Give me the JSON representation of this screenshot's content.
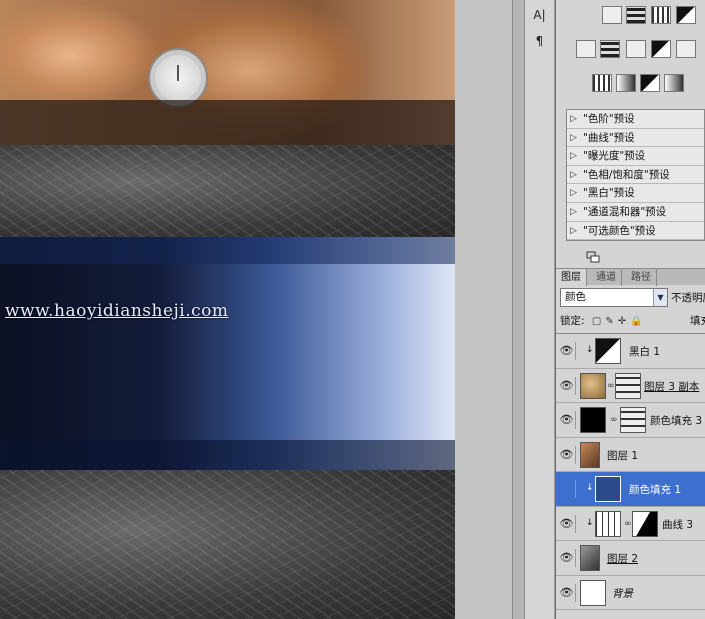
{
  "canvas": {
    "watermark": "www.haoyidiansheji.com"
  },
  "tools": {
    "items": [
      {
        "label": "A|",
        "icon": "character-panel-icon"
      },
      {
        "label": "¶",
        "icon": "paragraph-panel-icon"
      }
    ]
  },
  "adjustments": {
    "presets": [
      "\"色阶\"预设",
      "\"曲线\"预设",
      "\"曝光度\"预设",
      "\"色相/饱和度\"预设",
      "\"黑白\"预设",
      "\"通道混和器\"预设",
      "\"可选颜色\"预设"
    ]
  },
  "layers_panel": {
    "tabs": [
      "图层",
      "通道",
      "路径"
    ],
    "blend_mode": "颜色",
    "opacity_label": "不透明度",
    "lock_label": "锁定:",
    "fill_label": "填充",
    "layers": [
      {
        "name": "黑白 1",
        "clipped": true,
        "style": "normal",
        "selected": false
      },
      {
        "name": "图层 3 副本",
        "clipped": false,
        "style": "underline",
        "selected": false
      },
      {
        "name": "颜色填充 3",
        "clipped": false,
        "style": "normal",
        "selected": false
      },
      {
        "name": "图层 1",
        "clipped": false,
        "style": "normal",
        "selected": false
      },
      {
        "name": "颜色填充 1",
        "clipped": true,
        "style": "normal",
        "selected": true
      },
      {
        "name": "曲线 3",
        "clipped": true,
        "style": "normal",
        "selected": false
      },
      {
        "name": "图层 2",
        "clipped": false,
        "style": "underline",
        "selected": false
      },
      {
        "name": "背景",
        "clipped": false,
        "style": "italic",
        "selected": false
      }
    ]
  },
  "colors": {
    "selection": "#3d6fcf",
    "fill_blue": "#2a4a8a"
  }
}
